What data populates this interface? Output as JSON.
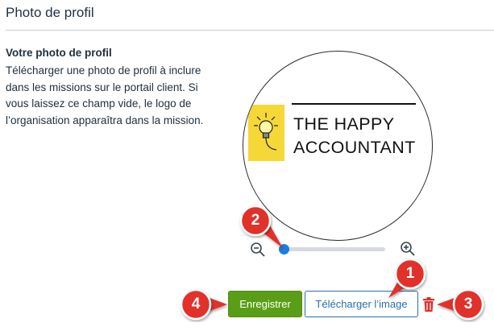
{
  "section": {
    "title": "Photo de profil"
  },
  "description": {
    "heading": "Votre photo de profil",
    "body": "Télécharger une photo de profil à inclure dans les missions sur le portail client. Si vous laissez ce champ vide, le logo de l’organisation apparaîtra dans la mission."
  },
  "preview": {
    "logo_text_line1": "THE HAPPY",
    "logo_text_line2": "ACCOUNTANT",
    "logo_icon": "lightbulb-icon",
    "logo_color": "#f5d838"
  },
  "zoom": {
    "min_icon": "zoom-out-icon",
    "max_icon": "zoom-in-icon",
    "level": 0.0
  },
  "actions": {
    "save_label": "Enregistrer",
    "upload_label": "Télécharger l’image",
    "delete_icon": "trash-icon"
  },
  "annotations": [
    "1",
    "2",
    "3",
    "4"
  ],
  "colors": {
    "primary_green": "#5a9e18",
    "link_blue": "#2a6fa8",
    "slider_blue": "#1a7de0",
    "annotation_red": "#e0312a",
    "delete_red": "#d9312b"
  }
}
